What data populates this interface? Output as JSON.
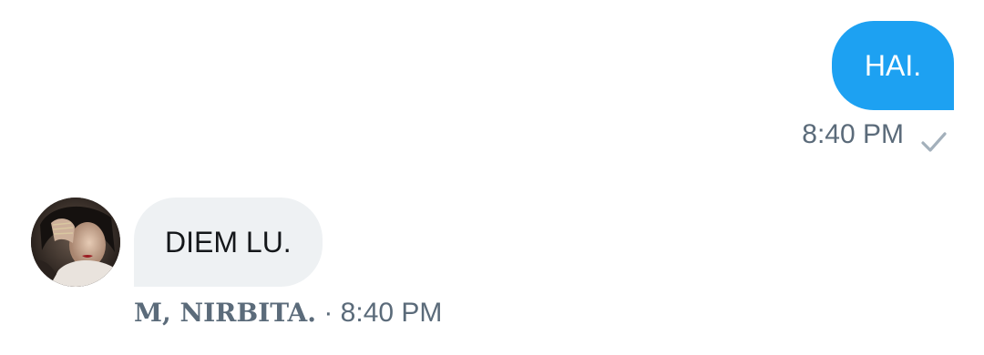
{
  "conversation": {
    "outgoing": {
      "text": "HAI.",
      "time": "8:40 PM",
      "status_icon": "check-icon"
    },
    "incoming": {
      "text": "DIEM LU.",
      "sender_name": "M, NIRBITA.",
      "separator": " · ",
      "time": "8:40 PM",
      "avatar_icon": "avatar"
    }
  },
  "colors": {
    "outgoing_bubble": "#1da1f2",
    "incoming_bubble": "#eef1f3",
    "meta_text": "#5b6b7a",
    "check": "#a3b0bb"
  }
}
